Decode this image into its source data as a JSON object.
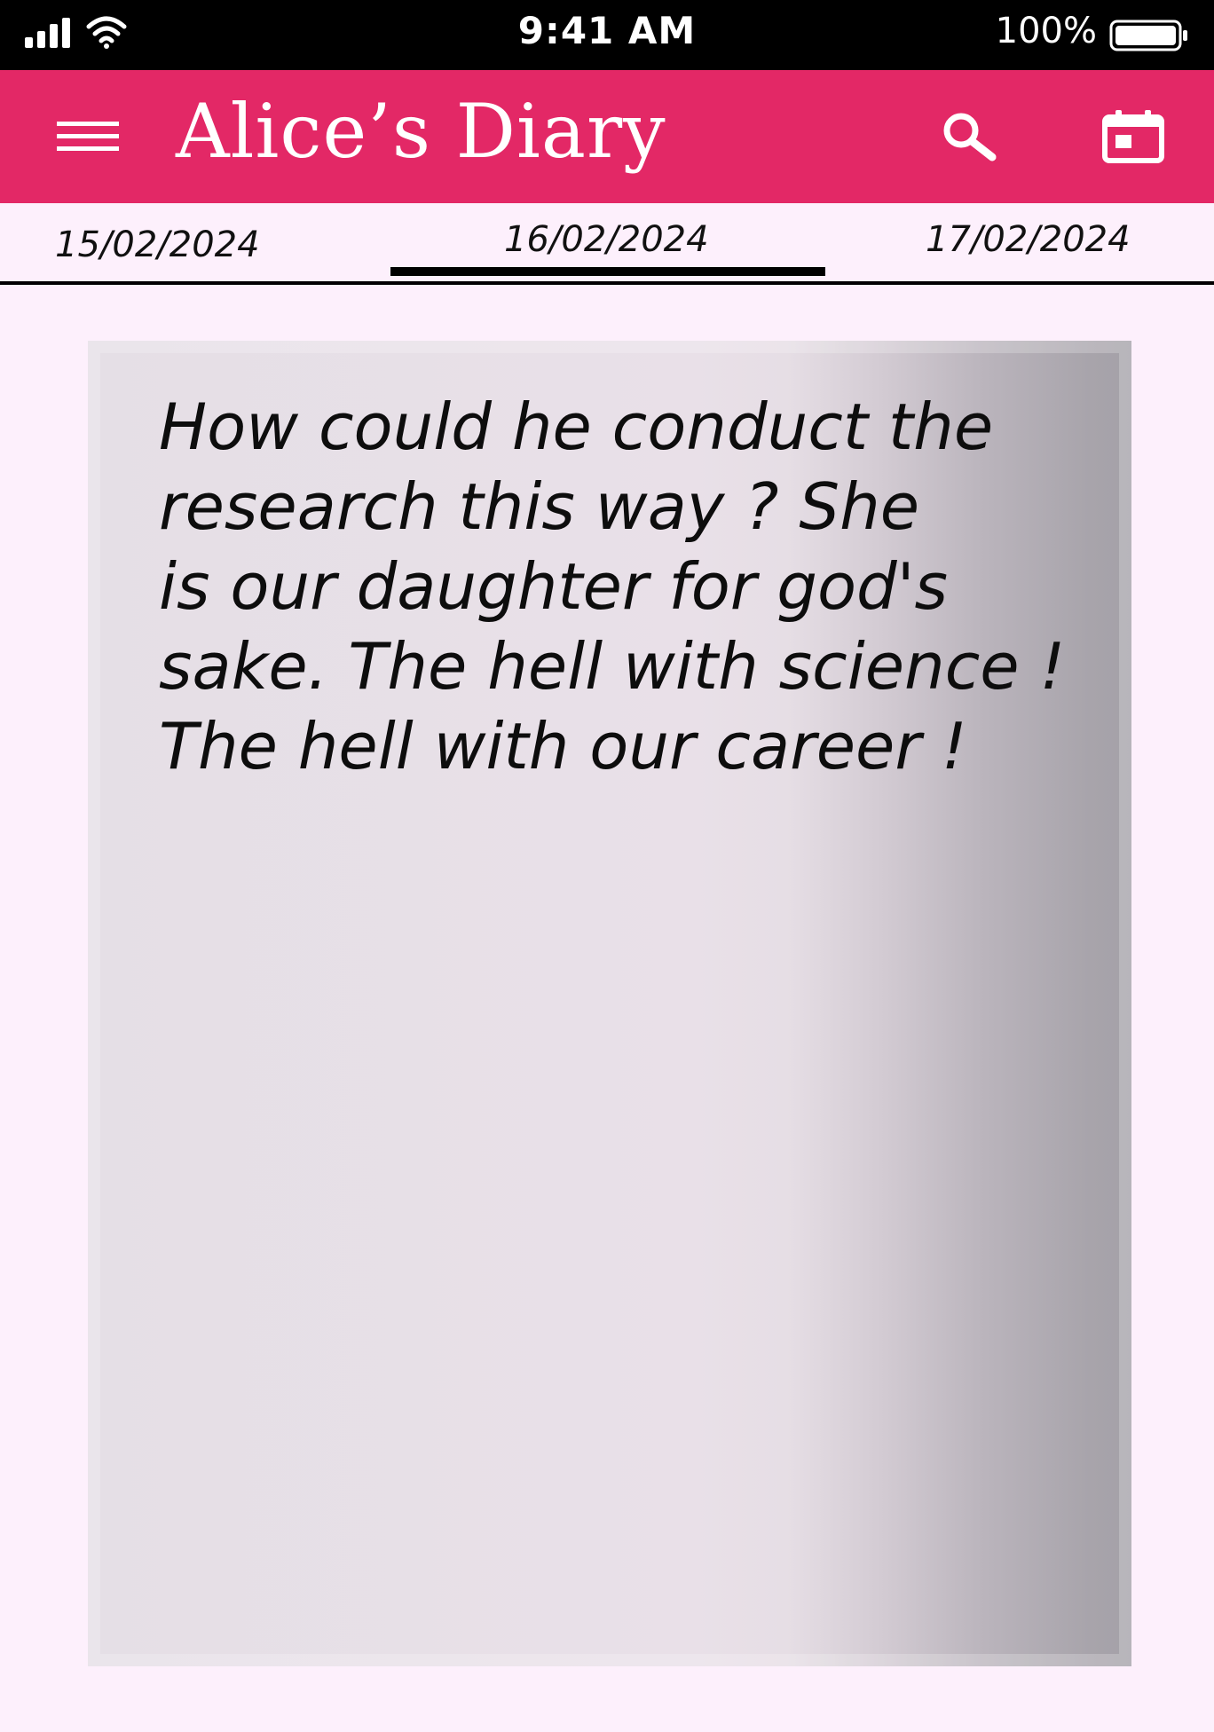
{
  "status_bar": {
    "time": "9:41 AM",
    "battery": "100%"
  },
  "app_bar": {
    "title": "Alice’s Diary",
    "icons": [
      "menu-icon",
      "search-icon",
      "calendar-icon"
    ]
  },
  "date_tabs": {
    "tabs": [
      {
        "label": "15/02/2024"
      },
      {
        "label": "16/02/2024",
        "selected": true
      },
      {
        "label": "17/02/2024"
      }
    ]
  },
  "entry": {
    "lines": [
      "How could he conduct the",
      "research this way ? She",
      "is our daughter for god's",
      "sake. The hell with science !",
      "The hell with our career !"
    ]
  },
  "colors": {
    "app_bar": "#e32866",
    "background": "#fdf0fc",
    "status_bar": "#000000"
  }
}
